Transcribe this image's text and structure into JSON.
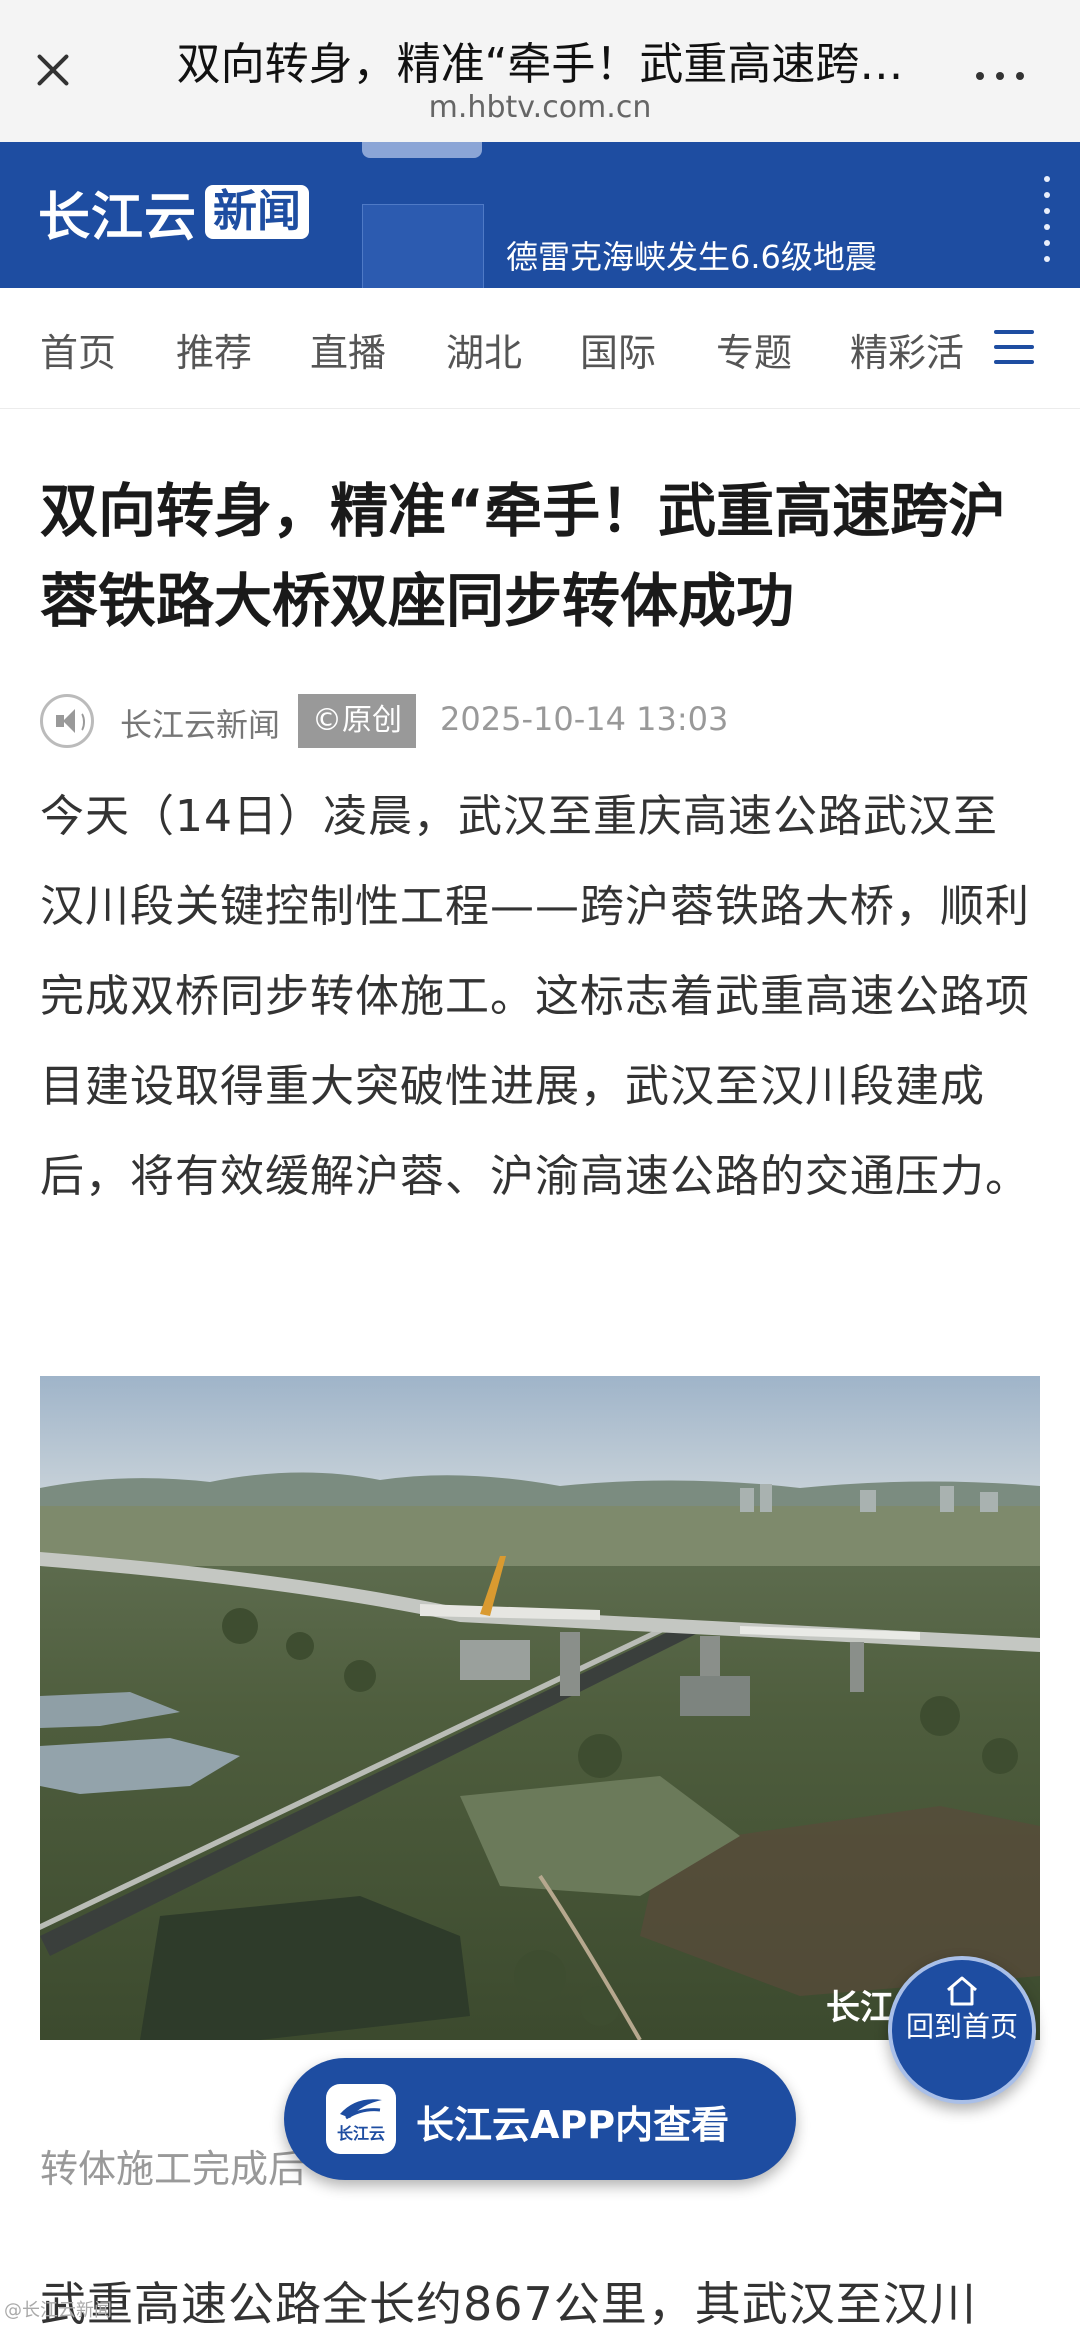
{
  "browser": {
    "title": "双向转身，精准“牵手！武重高速跨…",
    "domain": "m.hbtv.com.cn"
  },
  "banner": {
    "logo_a": "长江云",
    "logo_b": "新闻",
    "ticker": "德雷克海峡发生6.6级地震"
  },
  "nav": {
    "items": [
      "首页",
      "推荐",
      "直播",
      "湖北",
      "国际",
      "专题",
      "精彩活"
    ]
  },
  "article": {
    "headline": "双向转身，精准“牵手！武重高速跨沪蓉铁路大桥双座同步转体成功",
    "source": "长江云新闻",
    "badge": "©原创",
    "time": "2025-10-14 13:03",
    "paragraph": "今天（14日）凌晨，武汉至重庆高速公路武汉至汉川段关键控制性工程——跨沪蓉铁路大桥，顺利完成双桥同步转体施工。这标志着武重高速公路项目建设取得重大突破性进展，武汉至汉川段建成后，将有效缓解沪蓉、沪渝高速公路的交通压力。",
    "image_watermark": "长江",
    "caption": "转体施工完成后",
    "next_text": "武重高速公路全长约867公里，其武汉至汉川"
  },
  "floating": {
    "back_home": "回到首页",
    "app_logo": "长江云",
    "app_cta": "长江云APP内查看"
  },
  "corner_mark": "@长江云新闻"
}
